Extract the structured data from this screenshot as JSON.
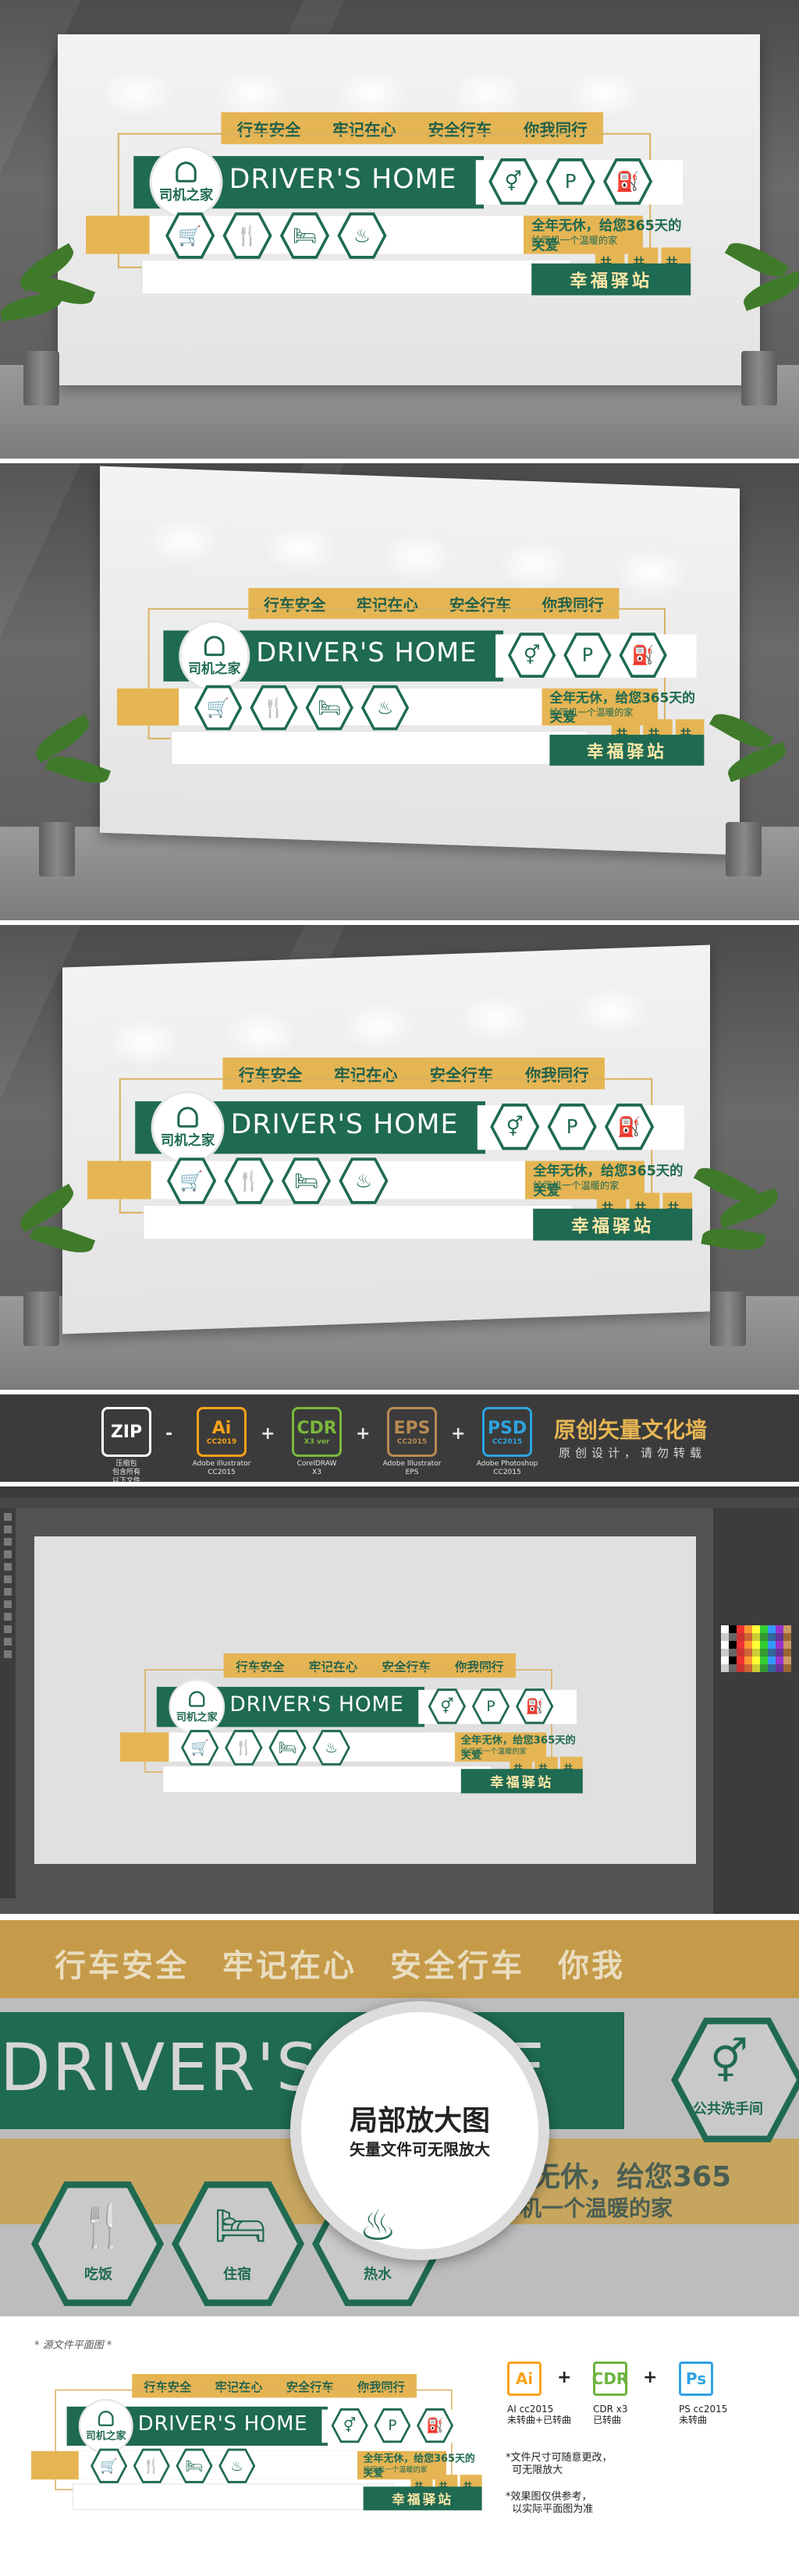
{
  "sign": {
    "slogans": [
      "行车安全",
      "牢记在心",
      "安全行车",
      "你我同行"
    ],
    "brand_cn": "司机之家",
    "brand_en": "DRIVER'S HOME",
    "care_line1": "全年无休，给您365天的关爱",
    "care_line2": "给司机一个温暖的家",
    "tags": [
      "共建",
      "共治",
      "共享"
    ],
    "station": "幸福驿站",
    "service_icons_top": [
      "restroom-icon",
      "parking-icon",
      "fuel-icon"
    ],
    "service_icons_bottom": [
      "cart-icon",
      "dining-icon",
      "bed-icon",
      "hot-water-icon"
    ]
  },
  "formats": {
    "items": [
      {
        "big": "ZIP",
        "small": "",
        "cap": "压缩包\n包含所有\n以下文件",
        "color": "#ffffff"
      },
      {
        "big": "Ai",
        "small": "CC2019",
        "cap": "Adobe Illustrator\nCC2015",
        "color": "#f7a21b"
      },
      {
        "big": "CDR",
        "small": "X3 ver",
        "cap": "CorelDRAW\nX3",
        "color": "#7ab83a"
      },
      {
        "big": "EPS",
        "small": "CC2015",
        "cap": "Adobe Illustrator\nEPS",
        "color": "#b78a52"
      },
      {
        "big": "PSD",
        "small": "CC2015",
        "cap": "Adobe Photoshop\nCC2015",
        "color": "#2da3e0"
      }
    ],
    "ops": [
      "-",
      "+",
      "+",
      "+"
    ],
    "title": "原创矢量文化墙",
    "subtitle": "原创设计，请勿转载"
  },
  "zoom": {
    "slogans": "行车安全　牢记在心　安全行车　你我",
    "brand_en": "DRIVER'S HOME",
    "care_line1": "全年无休，给您365",
    "care_line2": "给司机一个温暖的家",
    "hex_labels": [
      "吃饭",
      "住宿",
      "热水",
      "公共洗手间"
    ],
    "circle_title": "局部放大图",
    "circle_sub": "矢量文件可无限放大"
  },
  "footer": {
    "source_label": "* 源文件平面图 *",
    "softwares": [
      {
        "label": "Ai",
        "cap": "AI cc2015\n未转曲+已转曲",
        "color": "#f7a21b"
      },
      {
        "label": "CDR",
        "cap": "CDR x3\n已转曲",
        "color": "#6db33f"
      },
      {
        "label": "Ps",
        "cap": "PS cc2015\n未转曲",
        "color": "#2da3e0"
      }
    ],
    "note1": "*文件尺寸可随意更改，\n  可无限放大",
    "note2": "*效果图仅供参考，\n  以实际平面图为准"
  }
}
